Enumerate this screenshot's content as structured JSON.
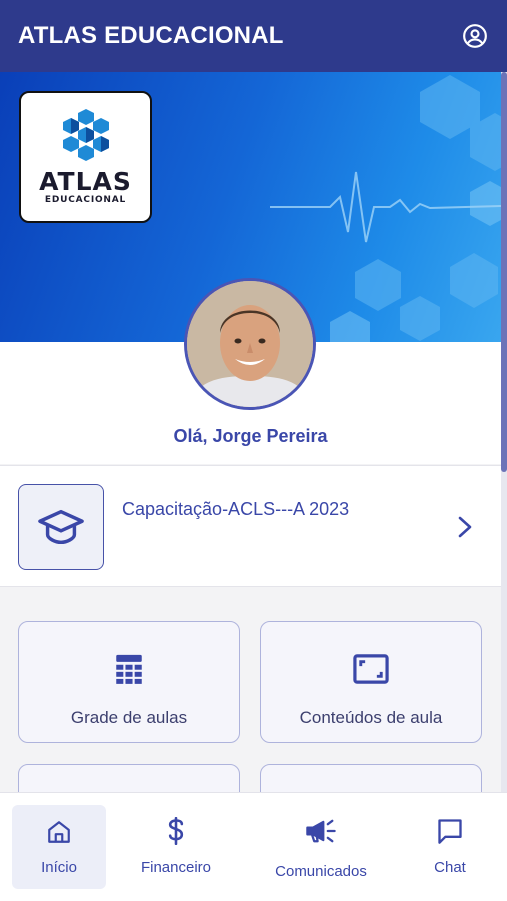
{
  "appbar": {
    "title": "ATLAS EDUCACIONAL",
    "account_icon": "account-circle-icon"
  },
  "banner": {
    "logo_word": "ATLAS",
    "logo_sub": "EDUCACIONAL"
  },
  "profile": {
    "greeting": "Olá, Jorge Pereira"
  },
  "course": {
    "name": "Capacitação-ACLS---A 2023",
    "icon": "graduation-cap-icon"
  },
  "shortcuts": [
    {
      "label": "Grade de aulas",
      "icon": "calendar-grid-icon"
    },
    {
      "label": "Conteúdos de aula",
      "icon": "screen-frame-icon"
    }
  ],
  "bottom_nav": [
    {
      "label": "Início",
      "icon": "home-icon",
      "active": true
    },
    {
      "label": "Financeiro",
      "icon": "dollar-icon",
      "active": false
    },
    {
      "label": "Comunicados",
      "icon": "megaphone-icon",
      "active": false
    },
    {
      "label": "Chat",
      "icon": "chat-icon",
      "active": false
    }
  ],
  "colors": {
    "primary": "#2e3a8c",
    "accent": "#3a47a8",
    "banner_blue": "#1466d6"
  }
}
